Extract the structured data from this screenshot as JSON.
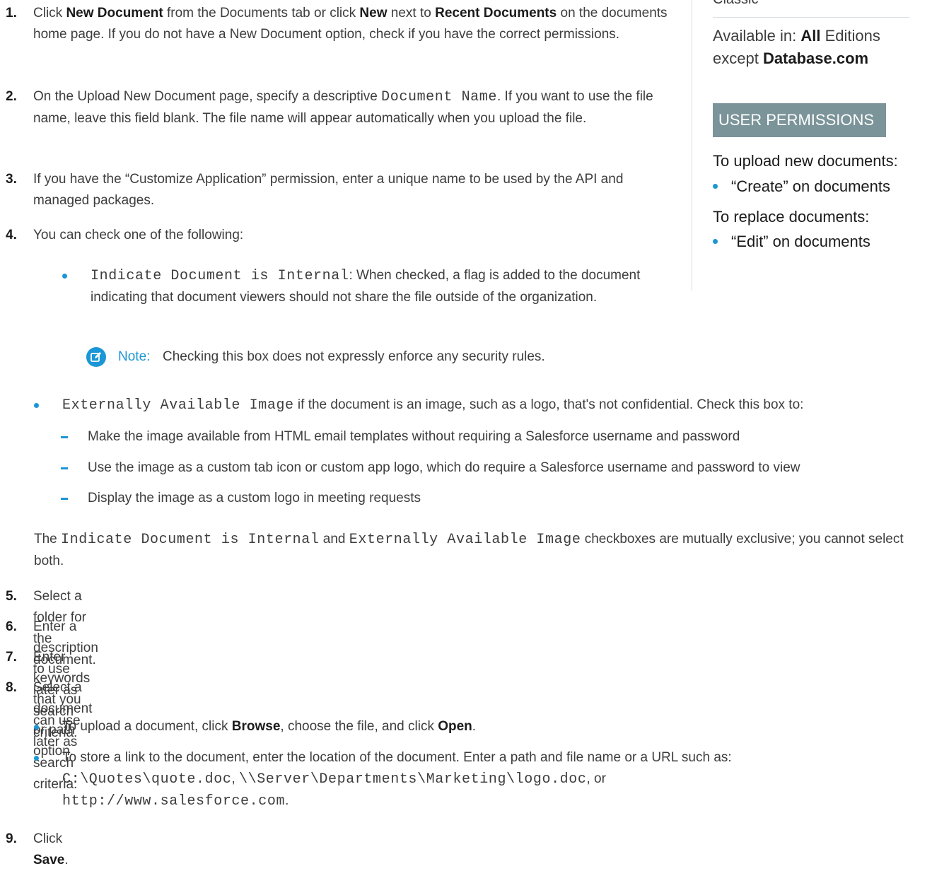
{
  "steps": {
    "s1": {
      "num": "1.",
      "a": "Click ",
      "b1": "New Document",
      "c": " from the Documents tab or click ",
      "b2": "New",
      "d": " next to ",
      "b3": "Recent Documents",
      "e": " on the documents home page. If you do not have a New Document option, check if you have the correct permissions."
    },
    "s2": {
      "num": "2.",
      "a": "On the Upload New Document page, specify a descriptive ",
      "code": "Document Name",
      "b": ". If you want to use the file name, leave this field blank. The file name will appear automatically when you upload the file."
    },
    "s3": {
      "num": "3.",
      "text": "If you have the “Customize Application” permission, enter a unique name to be used by the API and managed packages."
    },
    "s4": {
      "num": "4.",
      "text": "You can check one of the following:",
      "internal": {
        "code": "Indicate Document is Internal",
        "text": ": When checked, a flag is added to the document indicating that document viewers should not share the file outside of the organization."
      },
      "note": {
        "label": "Note:",
        "text": "Checking this box does not expressly enforce any security rules."
      },
      "external": {
        "code": "Externally Available Image",
        "text": " if the document is an image, such as a logo, that's not confidential. Check this box to:"
      },
      "sub": [
        "Make the image available from HTML email templates without requiring a Salesforce username and password",
        "Use the image as a custom tab icon or custom app logo, which do require a Salesforce username and password to view",
        "Display the image as a custom logo in meeting requests"
      ],
      "para": {
        "a": "The ",
        "code1": "Indicate Document is Internal",
        "b": " and ",
        "code2": "Externally Available Image",
        "c": " checkboxes are mutually exclusive; you cannot select both."
      }
    },
    "s5": {
      "num": "5.",
      "text": "Select a folder for the document."
    },
    "s6": {
      "num": "6.",
      "text": "Enter a description to use later as search criteria."
    },
    "s7": {
      "num": "7.",
      "text": "Enter keywords that you can use later as search criteria."
    },
    "s8": {
      "num": "8.",
      "text": "Select a document or path option.",
      "b1": {
        "a": "To upload a document, click ",
        "btn1": "Browse",
        "b": ", choose the file, and click ",
        "btn2": "Open",
        "c": "."
      },
      "b2": {
        "a": "To store a link to the document, enter the location of the document. Enter a path and file name or a URL such as:",
        "code1": "C:\\Quotes\\quote.doc",
        "sep1": ", ",
        "code2": "\\\\Server\\Departments\\Marketing\\logo.doc",
        "sep2": ", or",
        "code3": "http://www.salesforce.com",
        "end": "."
      }
    },
    "s9": {
      "num": "9.",
      "a": "Click ",
      "btn": "Save",
      "b": "."
    }
  },
  "sidebar": {
    "classic": "Classic",
    "avail_a": "Available in: ",
    "avail_b": "All",
    "avail_c": " Editions",
    "avail_d": "except ",
    "avail_e": "Database.com",
    "header": "USER PERMISSIONS",
    "upload_label": "To upload new documents:",
    "upload_perm": "“Create” on documents",
    "replace_label": "To replace documents:",
    "replace_perm": "“Edit” on documents"
  },
  "colors": {
    "accent": "#1b96d6",
    "header_bg": "#7b9499",
    "text": "#3d3d3d"
  }
}
